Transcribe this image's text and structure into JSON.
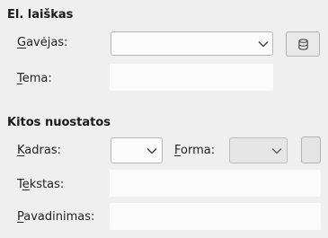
{
  "email_section": {
    "heading": "El. laiškas",
    "recipient": {
      "label_first": "G",
      "label_rest": "avėjas:",
      "value": ""
    },
    "subject": {
      "label_first": "T",
      "label_rest": "ema:",
      "value": ""
    },
    "address_book_button": {
      "icon": "database-icon"
    }
  },
  "other_settings_section": {
    "heading": "Kitos nuostatos",
    "frame": {
      "label_first": "K",
      "label_rest": "adras:",
      "value": ""
    },
    "form": {
      "label_first": "F",
      "label_rest": "orma:",
      "value": ""
    },
    "text": {
      "label_before": "T",
      "label_ul": "e",
      "label_rest": "kstas:",
      "value": ""
    },
    "name": {
      "label_first": "P",
      "label_rest": "avadinimas:",
      "value": ""
    }
  }
}
